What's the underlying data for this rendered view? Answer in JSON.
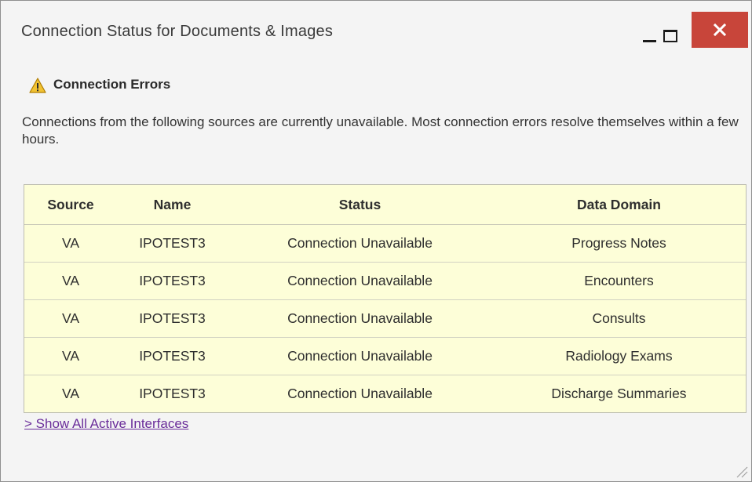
{
  "window": {
    "title": "Connection Status for Documents & Images"
  },
  "controls": {
    "minimize_icon": "minimize-icon",
    "maximize_icon": "maximize-icon",
    "close_icon": "close-icon",
    "close_color": "#c8453a"
  },
  "errors": {
    "icon": "warning-icon",
    "heading": "Connection Errors",
    "message": "Connections from the following sources are currently unavailable. Most connection errors resolve themselves within a few hours."
  },
  "table": {
    "columns": [
      "Source",
      "Name",
      "Status",
      "Data Domain"
    ],
    "rows": [
      [
        "VA",
        "IPOTEST3",
        "Connection Unavailable",
        "Progress Notes"
      ],
      [
        "VA",
        "IPOTEST3",
        "Connection Unavailable",
        "Encounters"
      ],
      [
        "VA",
        "IPOTEST3",
        "Connection Unavailable",
        "Consults"
      ],
      [
        "VA",
        "IPOTEST3",
        "Connection Unavailable",
        "Radiology Exams"
      ],
      [
        "VA",
        "IPOTEST3",
        "Connection Unavailable",
        "Discharge Summaries"
      ]
    ],
    "background": "#fdfed8"
  },
  "footer": {
    "link_label": "> Show All Active Interfaces",
    "link_color": "#6a2d9a"
  }
}
